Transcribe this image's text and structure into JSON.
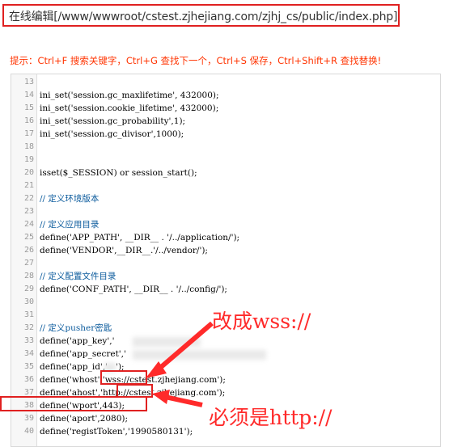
{
  "title": "在线编辑[/www/wwwroot/cstest.zjhejiang.com/zjhj_cs/public/index.php]",
  "tip": "提示：Ctrl+F 搜索关键字，Ctrl+G 查找下一个，Ctrl+S 保存，Ctrl+Shift+R 查找替换!",
  "lines": [
    {
      "n": "13",
      "t": ""
    },
    {
      "n": "14",
      "t": "ini_set('session.gc_maxlifetime', 432000);"
    },
    {
      "n": "15",
      "t": "ini_set('session.cookie_lifetime', 432000);"
    },
    {
      "n": "16",
      "t": "ini_set('session.gc_probability',1);"
    },
    {
      "n": "17",
      "t": "ini_set('session.gc_divisor',1000);"
    },
    {
      "n": "18",
      "t": ""
    },
    {
      "n": "19",
      "t": ""
    },
    {
      "n": "20",
      "t": "isset($_SESSION) or session_start();"
    },
    {
      "n": "21",
      "t": ""
    },
    {
      "n": "22",
      "t": "// 定义环境版本"
    },
    {
      "n": "23",
      "t": ""
    },
    {
      "n": "24",
      "t": "// 定义应用目录"
    },
    {
      "n": "25",
      "t": "define('APP_PATH', __DIR__ . '/../application/');"
    },
    {
      "n": "26",
      "t": "define('VENDOR',__DIR__.'/../vendor/');"
    },
    {
      "n": "27",
      "t": ""
    },
    {
      "n": "28",
      "t": "// 定义配置文件目录"
    },
    {
      "n": "29",
      "t": "define('CONF_PATH', __DIR__ . '/../config/');"
    },
    {
      "n": "30",
      "t": ""
    },
    {
      "n": "31",
      "t": ""
    },
    {
      "n": "32",
      "t": "// 定义pusher密匙"
    },
    {
      "n": "33",
      "t": "define('app_key','"
    },
    {
      "n": "34",
      "t": "define('app_secret','"
    },
    {
      "n": "35",
      "t": "define('app_id','   ');"
    },
    {
      "n": "36",
      "t": "define('whost','wss://cstest.zjhejiang.com');"
    },
    {
      "n": "37",
      "t": "define('ahost','http://cstest.zjhejiang.com');"
    },
    {
      "n": "38",
      "t": "define('wport',443);"
    },
    {
      "n": "39",
      "t": "define('aport',2080);"
    },
    {
      "n": "40",
      "t": "define('registToken','1990580131');"
    }
  ],
  "annotations": {
    "top": "改成wss://",
    "bottom": "必须是http://"
  },
  "colors": {
    "red": "#e02020",
    "comment": "#0a5a9c"
  }
}
